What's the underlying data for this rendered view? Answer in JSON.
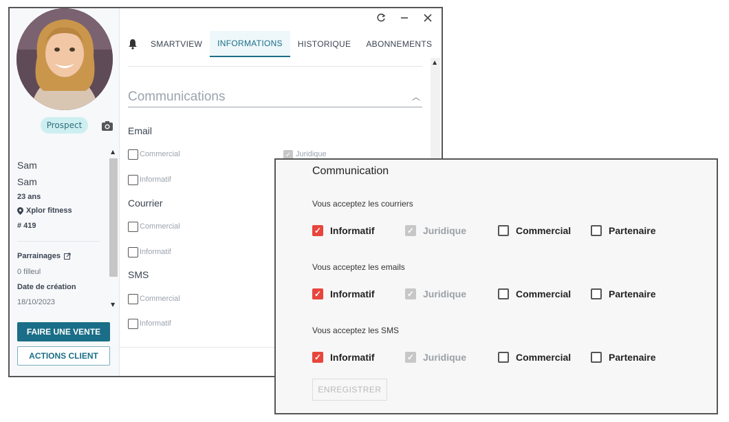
{
  "window": {
    "controls": [
      "refresh-icon",
      "minimize-icon",
      "close-icon"
    ]
  },
  "sidebar": {
    "badge": "Prospect",
    "first_name": "Sam",
    "last_name": "Sam",
    "age": "23 ans",
    "club": "Xplor fitness",
    "member_id": "# 419",
    "referrals_label": "Parrainages",
    "referrals_value": "0 filleul",
    "created_label": "Date de création",
    "created_value": "18/10/2023",
    "primary_button": "FAIRE UNE VENTE",
    "secondary_button": "ACTIONS CLIENT"
  },
  "tabs": [
    {
      "label": "SMARTVIEW",
      "active": false
    },
    {
      "label": "INFORMATIONS",
      "active": true
    },
    {
      "label": "HISTORIQUE",
      "active": false
    },
    {
      "label": "ABONNEMENTS",
      "active": false
    }
  ],
  "more_label": "•••",
  "communications": {
    "title": "Communications",
    "email": {
      "heading": "Email",
      "commercial": "Commercial",
      "informatif": "Informatif",
      "juridique": "Juridique"
    },
    "courrier": {
      "heading": "Courrier",
      "commercial": "Commercial",
      "informatif": "Informatif"
    },
    "sms": {
      "heading": "SMS",
      "commercial": "Commercial",
      "informatif": "Informatif"
    }
  },
  "dialog": {
    "title": "Communication",
    "groups": [
      {
        "question": "Vous acceptez les courriers",
        "options": [
          {
            "label": "Informatif",
            "state": "checked"
          },
          {
            "label": "Juridique",
            "state": "disabled-checked"
          },
          {
            "label": "Commercial",
            "state": "unchecked"
          },
          {
            "label": "Partenaire",
            "state": "unchecked"
          }
        ]
      },
      {
        "question": "Vous acceptez les emails",
        "options": [
          {
            "label": "Informatif",
            "state": "checked"
          },
          {
            "label": "Juridique",
            "state": "disabled-checked"
          },
          {
            "label": "Commercial",
            "state": "unchecked"
          },
          {
            "label": "Partenaire",
            "state": "unchecked"
          }
        ]
      },
      {
        "question": "Vous acceptez les SMS",
        "options": [
          {
            "label": "Informatif",
            "state": "checked"
          },
          {
            "label": "Juridique",
            "state": "disabled-checked"
          },
          {
            "label": "Commercial",
            "state": "unchecked"
          },
          {
            "label": "Partenaire",
            "state": "unchecked"
          }
        ]
      }
    ],
    "save_label": "ENREGISTRER"
  },
  "colors": {
    "accent": "#1a6e87",
    "checked": "#e8463c",
    "disabled": "#c7c7c7",
    "badge_bg": "#cdeff2"
  }
}
